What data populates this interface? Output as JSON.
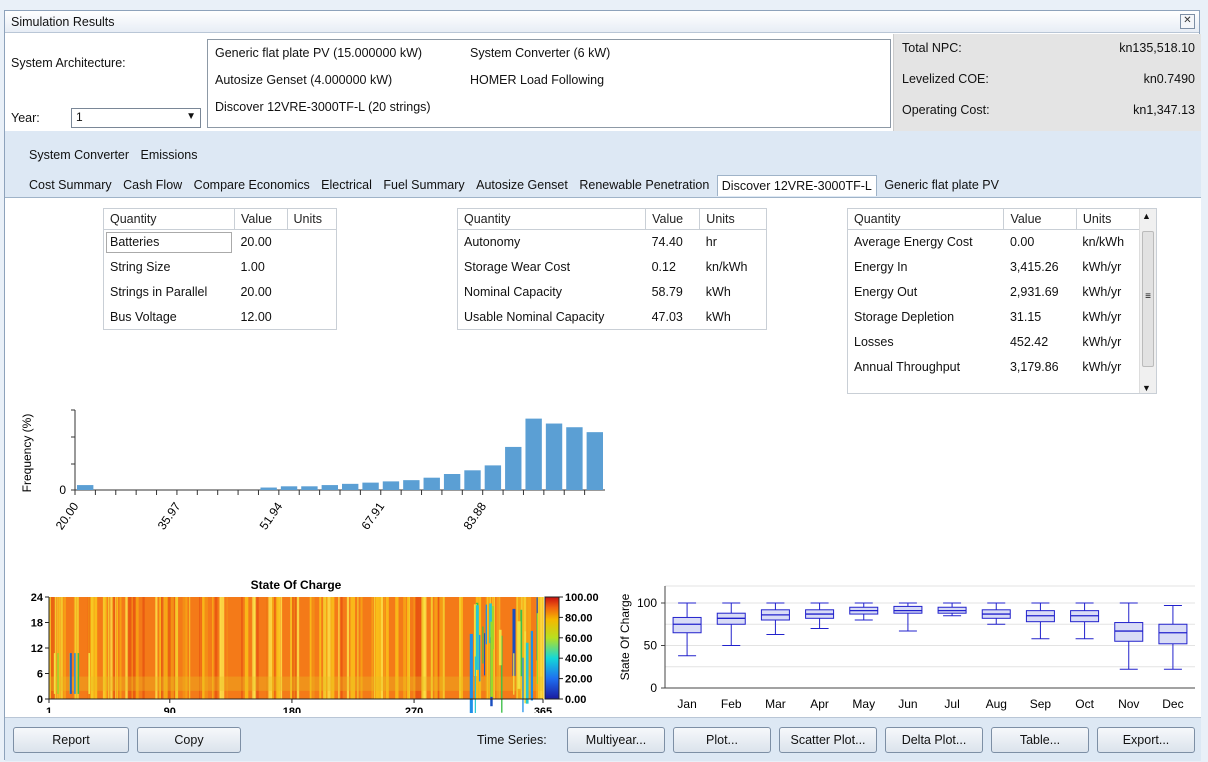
{
  "window": {
    "title": "Simulation Results"
  },
  "architecture": {
    "label": "System Architecture:",
    "year_label": "Year:",
    "year_value": "1",
    "components": [
      "Generic flat plate PV (15.000000 kW)",
      "System Converter (6 kW)",
      "Autosize Genset (4.000000 kW)",
      "HOMER Load Following",
      "Discover 12VRE-3000TF-L (20 strings)"
    ]
  },
  "metrics": [
    {
      "label": "Total NPC:",
      "value": "kn135,518.10"
    },
    {
      "label": "Levelized COE:",
      "value": "kn0.7490"
    },
    {
      "label": "Operating Cost:",
      "value": "kn1,347.13"
    }
  ],
  "tabs_row1": [
    "System Converter",
    "Emissions"
  ],
  "tabs_row2": [
    "Cost Summary",
    "Cash Flow",
    "Compare Economics",
    "Electrical",
    "Fuel Summary",
    "Autosize Genset",
    "Renewable Penetration",
    "Discover 12VRE-3000TF-L",
    "Generic flat plate PV"
  ],
  "active_tab": "Discover 12VRE-3000TF-L",
  "tables": {
    "headers": [
      "Quantity",
      "Value",
      "Units"
    ],
    "t1": [
      [
        "Batteries",
        "20.00",
        ""
      ],
      [
        "String Size",
        "1.00",
        ""
      ],
      [
        "Strings in Parallel",
        "20.00",
        ""
      ],
      [
        "Bus Voltage",
        "12.00",
        ""
      ]
    ],
    "t2": [
      [
        "Autonomy",
        "74.40",
        "hr"
      ],
      [
        "Storage Wear Cost",
        "0.12",
        "kn/kWh"
      ],
      [
        "Nominal Capacity",
        "58.79",
        "kWh"
      ],
      [
        "Usable Nominal Capacity",
        "47.03",
        "kWh"
      ]
    ],
    "t3": [
      [
        "Average Energy Cost",
        "0.00",
        "kn/kWh"
      ],
      [
        "Energy In",
        "3,415.26",
        "kWh/yr"
      ],
      [
        "Energy Out",
        "2,931.69",
        "kWh/yr"
      ],
      [
        "Storage Depletion",
        "31.15",
        "kWh/yr"
      ],
      [
        "Losses",
        "452.42",
        "kWh/yr"
      ],
      [
        "Annual Throughput",
        "3,179.86",
        "kWh/yr"
      ]
    ]
  },
  "histogram": {
    "ylabel": "Frequency (%)",
    "y_tick": "0",
    "x_ticks": [
      "20.00",
      "35.97",
      "51.94",
      "67.91",
      "83.88"
    ],
    "values": [
      0.4,
      0,
      0,
      0,
      0,
      0,
      0,
      0,
      0,
      0.2,
      0.3,
      0.3,
      0.4,
      0.5,
      0.6,
      0.7,
      0.8,
      1.0,
      1.3,
      1.6,
      2.0,
      3.5,
      5.8,
      5.4,
      5.1,
      4.7
    ]
  },
  "heatmap": {
    "title": "State Of Charge",
    "y_ticks": [
      "24",
      "18",
      "12",
      "6",
      "0"
    ],
    "x_ticks": [
      "1",
      "90",
      "180",
      "270",
      "365"
    ],
    "scale_ticks": [
      "100.00",
      "80.00",
      "60.00",
      "40.00",
      "20.00",
      "0.00"
    ]
  },
  "boxplot": {
    "ylabel": "State Of Charge",
    "y_ticks": [
      "100",
      "50",
      "0"
    ],
    "months": [
      "Jan",
      "Feb",
      "Mar",
      "Apr",
      "May",
      "Jun",
      "Jul",
      "Aug",
      "Sep",
      "Oct",
      "Nov",
      "Dec"
    ]
  },
  "footer": {
    "report": "Report",
    "copy": "Copy",
    "ts_label": "Time Series:",
    "buttons": [
      "Multiyear...",
      "Plot...",
      "Scatter Plot...",
      "Delta Plot...",
      "Table...",
      "Export..."
    ]
  },
  "chart_data": [
    {
      "type": "bar",
      "title": "",
      "ylabel": "Frequency (%)",
      "x_tick_labels": [
        "20.00",
        "35.97",
        "51.94",
        "67.91",
        "83.88"
      ],
      "values": [
        0.4,
        0,
        0,
        0,
        0,
        0,
        0,
        0,
        0,
        0.2,
        0.3,
        0.3,
        0.4,
        0.5,
        0.6,
        0.7,
        0.8,
        1.0,
        1.3,
        1.6,
        2.0,
        3.5,
        5.8,
        5.4,
        5.1,
        4.7
      ]
    },
    {
      "type": "heatmap",
      "title": "State Of Charge",
      "x_range": [
        1,
        365
      ],
      "y_range": [
        0,
        24
      ],
      "color_range": [
        0,
        100
      ]
    },
    {
      "type": "box",
      "ylabel": "State Of Charge",
      "categories": [
        "Jan",
        "Feb",
        "Mar",
        "Apr",
        "May",
        "Jun",
        "Jul",
        "Aug",
        "Sep",
        "Oct",
        "Nov",
        "Dec"
      ],
      "min": [
        38,
        50,
        63,
        70,
        80,
        67,
        85,
        75,
        58,
        58,
        22,
        22
      ],
      "q1": [
        65,
        75,
        80,
        82,
        87,
        88,
        88,
        82,
        78,
        78,
        55,
        52
      ],
      "median": [
        75,
        82,
        86,
        87,
        91,
        91,
        91,
        87,
        85,
        85,
        67,
        65
      ],
      "q3": [
        83,
        88,
        92,
        92,
        95,
        96,
        95,
        92,
        91,
        91,
        77,
        75
      ],
      "max": [
        100,
        100,
        100,
        100,
        100,
        100,
        100,
        100,
        100,
        100,
        100,
        97
      ],
      "ylim": [
        0,
        120
      ]
    }
  ]
}
